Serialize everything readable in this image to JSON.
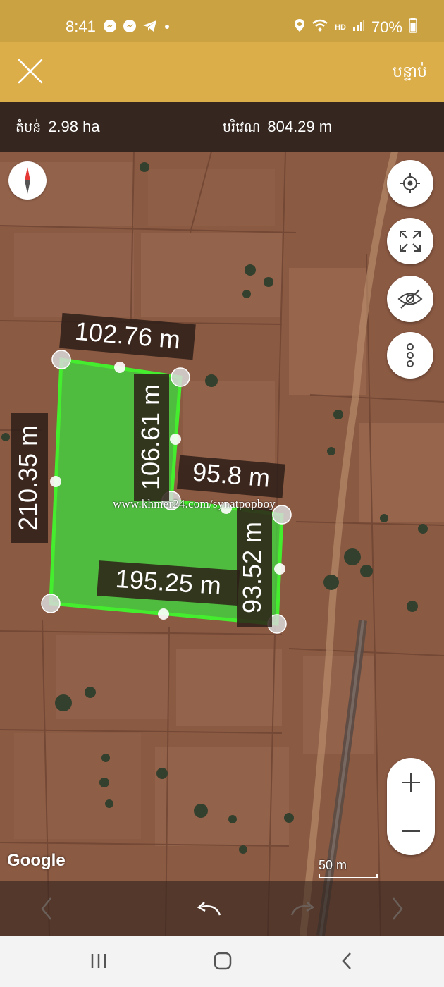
{
  "status_bar": {
    "time": "8:41",
    "notification_icons": [
      "messenger-icon",
      "messenger-icon",
      "telegram-icon",
      "dot-icon"
    ],
    "network_label": "HD",
    "battery": "70%"
  },
  "app_bar": {
    "next_label": "បន្ទាប់"
  },
  "measurements": {
    "area_label": "តំបន់",
    "area_value": "2.98 ha",
    "perimeter_label": "បរិវេណ",
    "perimeter_value": "804.29 m"
  },
  "map": {
    "polygon_fill": "#3fd63f",
    "polygon_stroke": "#44ee2e",
    "edge_labels": [
      "102.76 m",
      "106.61 m",
      "95.8 m",
      "93.52 m",
      "195.25 m",
      "210.35 m"
    ],
    "watermark": "www.khmer24.com/synatpopboy",
    "attribution": "Google",
    "scale_label": "50 m"
  },
  "colors": {
    "status_bar": "#caa241",
    "app_bar": "#dcae4a",
    "measure_bar": "#35271f",
    "map_soil": "#8b5a43"
  }
}
